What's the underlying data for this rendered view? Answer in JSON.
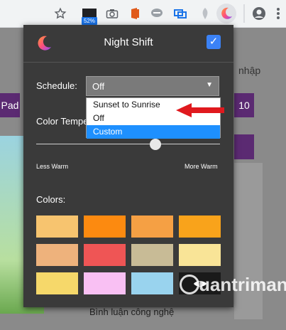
{
  "browser": {
    "badge": "52%"
  },
  "background": {
    "right_text": "nhập",
    "left_button": "Pad",
    "right_button": "10",
    "bottom_text": "Bình luận công nghệ"
  },
  "popup": {
    "title": "Night Shift",
    "enabled": true,
    "schedule_label": "Schedule:",
    "schedule_value": "Off",
    "options": [
      "Sunset to Sunrise",
      "Off",
      "Custom"
    ],
    "selected_option": "Custom",
    "color_temp_label": "Color Tempe",
    "slider_level": 0.65,
    "less_warm": "Less Warm",
    "more_warm": "More Warm",
    "colors_label": "Colors:",
    "swatches": [
      "#f7c46f",
      "#fc8a10",
      "#f5a044",
      "#f9a31b",
      "#eeb27c",
      "#ef5555",
      "#c8bb96",
      "#f9e497",
      "#f6d86a",
      "#f9c0f3",
      "#99d3ee",
      "#1a1a1a"
    ]
  },
  "watermark": "uantrimang"
}
